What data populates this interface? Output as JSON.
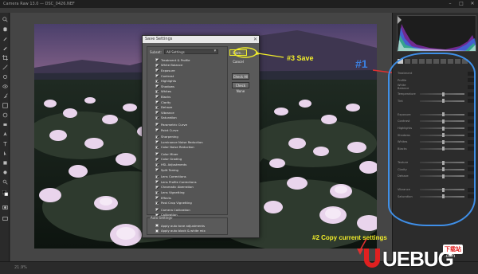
{
  "window": {
    "title": "Camera Raw 13.0 — DSC_0426.NEF",
    "controls": [
      "–",
      "□",
      "✕"
    ]
  },
  "dialog": {
    "title": "Save Settings",
    "close": "✕",
    "subset_label": "Subset:",
    "subset_value": "All Settings",
    "buttons": {
      "save": "Save...",
      "cancel": "Cancel",
      "check_all": "Check All",
      "check_none": "Check None"
    },
    "options": [
      {
        "label": "Treatment & Profile",
        "checked": true
      },
      {
        "label": "White Balance",
        "checked": true
      },
      {
        "label": "Exposure",
        "checked": true
      },
      {
        "label": "Contrast",
        "checked": true
      },
      {
        "label": "Highlights",
        "checked": true
      },
      {
        "label": "Shadows",
        "checked": true
      },
      {
        "label": "Whites",
        "checked": true
      },
      {
        "label": "Blacks",
        "checked": true
      },
      {
        "label": "Clarity",
        "checked": true
      },
      {
        "label": "Dehaze",
        "checked": true
      },
      {
        "label": "Vibrance",
        "checked": true
      },
      {
        "label": "Saturation",
        "checked": true
      },
      {
        "label": "Parametric Curve",
        "checked": true,
        "gap": true
      },
      {
        "label": "Point Curve",
        "checked": true
      },
      {
        "label": "Sharpening",
        "checked": true,
        "gap": true
      },
      {
        "label": "Luminance Noise Reduction",
        "checked": true
      },
      {
        "label": "Color Noise Reduction",
        "checked": true
      },
      {
        "label": "Color Mixer",
        "checked": true,
        "gap": true
      },
      {
        "label": "Color Grading",
        "checked": true
      },
      {
        "label": "HSL Adjustments",
        "checked": true
      },
      {
        "label": "Split Toning",
        "checked": true
      },
      {
        "label": "Lens Corrections",
        "checked": true,
        "gap": true
      },
      {
        "label": "Lens Profile Corrections",
        "checked": true
      },
      {
        "label": "Chromatic Aberration",
        "checked": true
      },
      {
        "label": "Lens Vignetting",
        "checked": true
      },
      {
        "label": "Effects",
        "checked": true
      },
      {
        "label": "Post Crop Vignetting",
        "checked": true
      },
      {
        "label": "Camera Calibration",
        "checked": true,
        "gap": true
      },
      {
        "label": "Calibration",
        "checked": true
      }
    ],
    "auto_group_label": "Auto Settings",
    "auto_options": [
      {
        "label": "Apply auto tone adjustments",
        "checked": false
      },
      {
        "label": "Apply auto black & white mix",
        "checked": false
      }
    ]
  },
  "annotations": {
    "save": "#3 Save",
    "panel": "#1",
    "copy": "#2 Copy current settings"
  },
  "panel": {
    "rows": [
      {
        "label": "Treatment",
        "type": "plain"
      },
      {
        "label": "Profile",
        "type": "plain"
      },
      {
        "label": "White Balance",
        "type": "plain"
      },
      {
        "label": "Temperature",
        "type": "slider",
        "knob": 0.5
      },
      {
        "label": "Tint",
        "type": "slider",
        "knob": 0.5
      },
      {
        "label": "",
        "type": "header"
      },
      {
        "label": "Exposure",
        "type": "slider",
        "knob": 0.5
      },
      {
        "label": "Contrast",
        "type": "slider",
        "knob": 0.5
      },
      {
        "label": "Highlights",
        "type": "slider",
        "knob": 0.5
      },
      {
        "label": "Shadows",
        "type": "slider",
        "knob": 0.5
      },
      {
        "label": "Whites",
        "type": "slider",
        "knob": 0.5
      },
      {
        "label": "Blacks",
        "type": "slider",
        "knob": 0.5
      },
      {
        "label": "",
        "type": "header"
      },
      {
        "label": "Texture",
        "type": "slider",
        "knob": 0.5
      },
      {
        "label": "Clarity",
        "type": "slider",
        "knob": 0.5
      },
      {
        "label": "Dehaze",
        "type": "slider",
        "knob": 0.5
      },
      {
        "label": "",
        "type": "header"
      },
      {
        "label": "Vibrance",
        "type": "slider",
        "knob": 0.5
      },
      {
        "label": "Saturation",
        "type": "slider",
        "knob": 0.5
      }
    ]
  },
  "bottom": {
    "zoom": "21.9%"
  },
  "watermark": {
    "brand": "UEBUG",
    "badge": "下载站",
    "domain": ".com"
  },
  "colors": {
    "annotation_yellow": "#f2ee2a",
    "annotation_blue": "#3b7fe0"
  }
}
